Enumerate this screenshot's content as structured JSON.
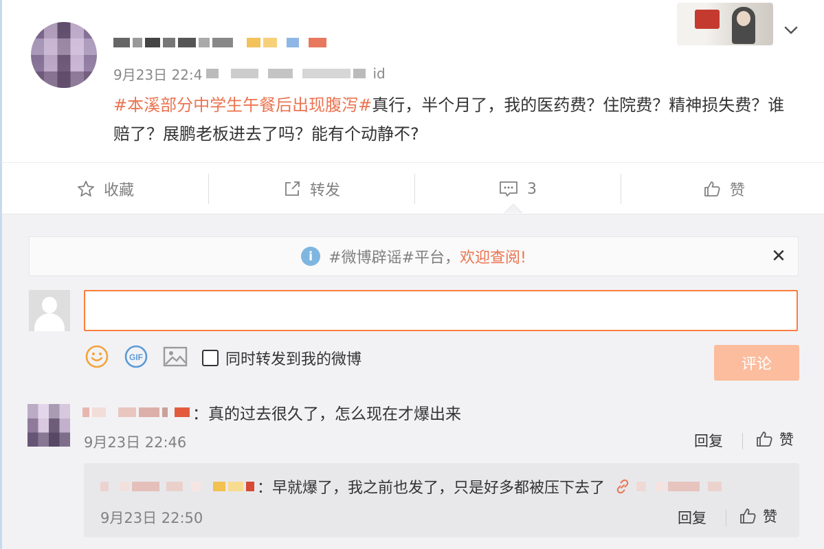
{
  "post": {
    "time": "9月23日 22:4",
    "device_suffix": "id",
    "topic": "#本溪部分中学生午餐后出现腹泻#",
    "text": "真行，半个月了，我的医药费？住院费？精神损失费？谁赔了？展鹏老板进去了吗？能有个动静不?"
  },
  "actions": {
    "favorite_label": "收藏",
    "repost_label": "转发",
    "comment_count": "3",
    "like_label": "赞"
  },
  "notice": {
    "prefix": "#微博辟谣#平台，",
    "link": "欢迎查阅!"
  },
  "composer": {
    "input_value": "",
    "repost_option": "同时转发到我的微博",
    "submit_label": "评论"
  },
  "comment": {
    "text": "：真的过去很久了，怎么现在才爆出来",
    "time": "9月23日 22:46",
    "reply_label": "回复",
    "like_label": "赞"
  },
  "subreply": {
    "text": "：早就爆了，我之前也发了，只是好多都被压下去了",
    "time": "9月23日 22:50",
    "reply_label": "回复",
    "like_label": "赞"
  },
  "icons": {
    "favorite": "star-icon",
    "repost": "share-icon",
    "comment": "comment-icon",
    "like": "thumbs-up-icon",
    "notice": "info-icon",
    "close": "close-icon",
    "emoji": "smiley-icon",
    "gif": "gif-icon",
    "image": "image-icon",
    "link": "link-icon",
    "menu": "chevron-down-icon"
  },
  "colors": {
    "accent": "#eb7350",
    "input_border": "#fa7d3c",
    "submit_bg": "#fbbd9e",
    "panel_bg": "#f2f2f5",
    "icon_blue": "#7fb6e0"
  }
}
